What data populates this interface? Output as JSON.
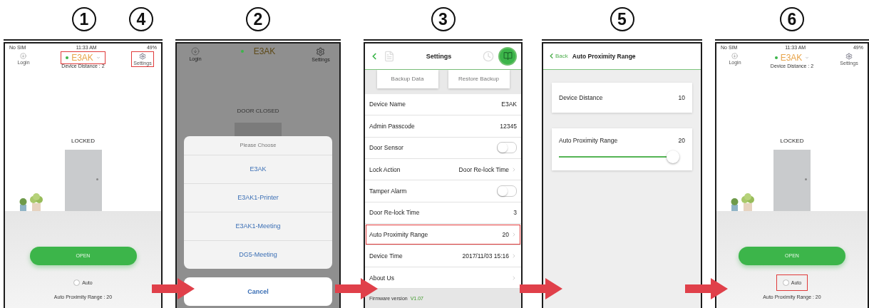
{
  "steps": [
    {
      "kind": "home",
      "markers": [
        "1",
        "4"
      ],
      "status": {
        "carrier": "No SIM",
        "time": "11:33 AM",
        "battery": "49%"
      },
      "login": "Login",
      "device_name": "E3AK",
      "name_highlight": true,
      "device_distance": "Device Distance : 2",
      "settings": "Settings",
      "settings_highlight": true,
      "door_status": "LOCKED",
      "open_button": "OPEN",
      "auto": {
        "label": "Auto",
        "checked": false,
        "highlight": false
      },
      "range_text": "Auto Proximity Range : 20"
    },
    {
      "kind": "picker",
      "markers": [
        "2"
      ],
      "background": {
        "login": "Login",
        "device_name": "E3AK",
        "settings": "Settings",
        "door_status": "DOOR CLOSED"
      },
      "sheet": {
        "title": "Please Choose",
        "options": [
          "E3AK",
          "E3AK1-Printer",
          "E3AK1-Meeting",
          "DG5-Meeting"
        ],
        "cancel": "Cancel"
      }
    },
    {
      "kind": "settings",
      "markers": [
        "3"
      ],
      "title": "Settings",
      "actions": [
        "Backup Data",
        "Restore Backup"
      ],
      "rows": [
        {
          "kind": "value",
          "label": "Device Name",
          "value": "E3AK",
          "chevron": false,
          "highlight": false
        },
        {
          "kind": "value",
          "label": "Admin Passcode",
          "value": "12345",
          "chevron": false,
          "highlight": false
        },
        {
          "kind": "toggle",
          "label": "Door Sensor",
          "on": false,
          "highlight": false
        },
        {
          "kind": "value",
          "label": "Lock Action",
          "value": "Door Re-lock Time",
          "chevron": true,
          "highlight": false
        },
        {
          "kind": "toggle",
          "label": "Tamper Alarm",
          "on": false,
          "highlight": false
        },
        {
          "kind": "value",
          "label": "Door Re-lock Time",
          "value": "3",
          "chevron": false,
          "highlight": false
        },
        {
          "kind": "value",
          "label": "Auto Proximity Range",
          "value": "20",
          "chevron": true,
          "highlight": true
        },
        {
          "kind": "value",
          "label": "Device Time",
          "value": "2017/11/03 15:16",
          "chevron": true,
          "highlight": false
        },
        {
          "kind": "link",
          "label": "About Us",
          "highlight": false
        }
      ],
      "firmware": {
        "label": "Firmware version",
        "version": "V1.07"
      }
    },
    {
      "kind": "range",
      "markers": [
        "5"
      ],
      "back": "Back",
      "title": "Auto Proximity Range",
      "distance": {
        "label": "Device Distance",
        "value": "10"
      },
      "range": {
        "label": "Auto Proximity Range",
        "value": "20",
        "level": 0.95
      }
    },
    {
      "kind": "home",
      "markers": [
        "6"
      ],
      "status": {
        "carrier": "No SIM",
        "time": "11:33 AM",
        "battery": "49%"
      },
      "login": "Login",
      "device_name": "E3AK",
      "name_highlight": false,
      "device_distance": "Device Distance : 2",
      "settings": "Settings",
      "settings_highlight": false,
      "door_status": "LOCKED",
      "open_button": "OPEN",
      "auto": {
        "label": "Auto",
        "checked": false,
        "highlight": true
      },
      "range_text": "Auto Proximity Range : 20"
    }
  ]
}
